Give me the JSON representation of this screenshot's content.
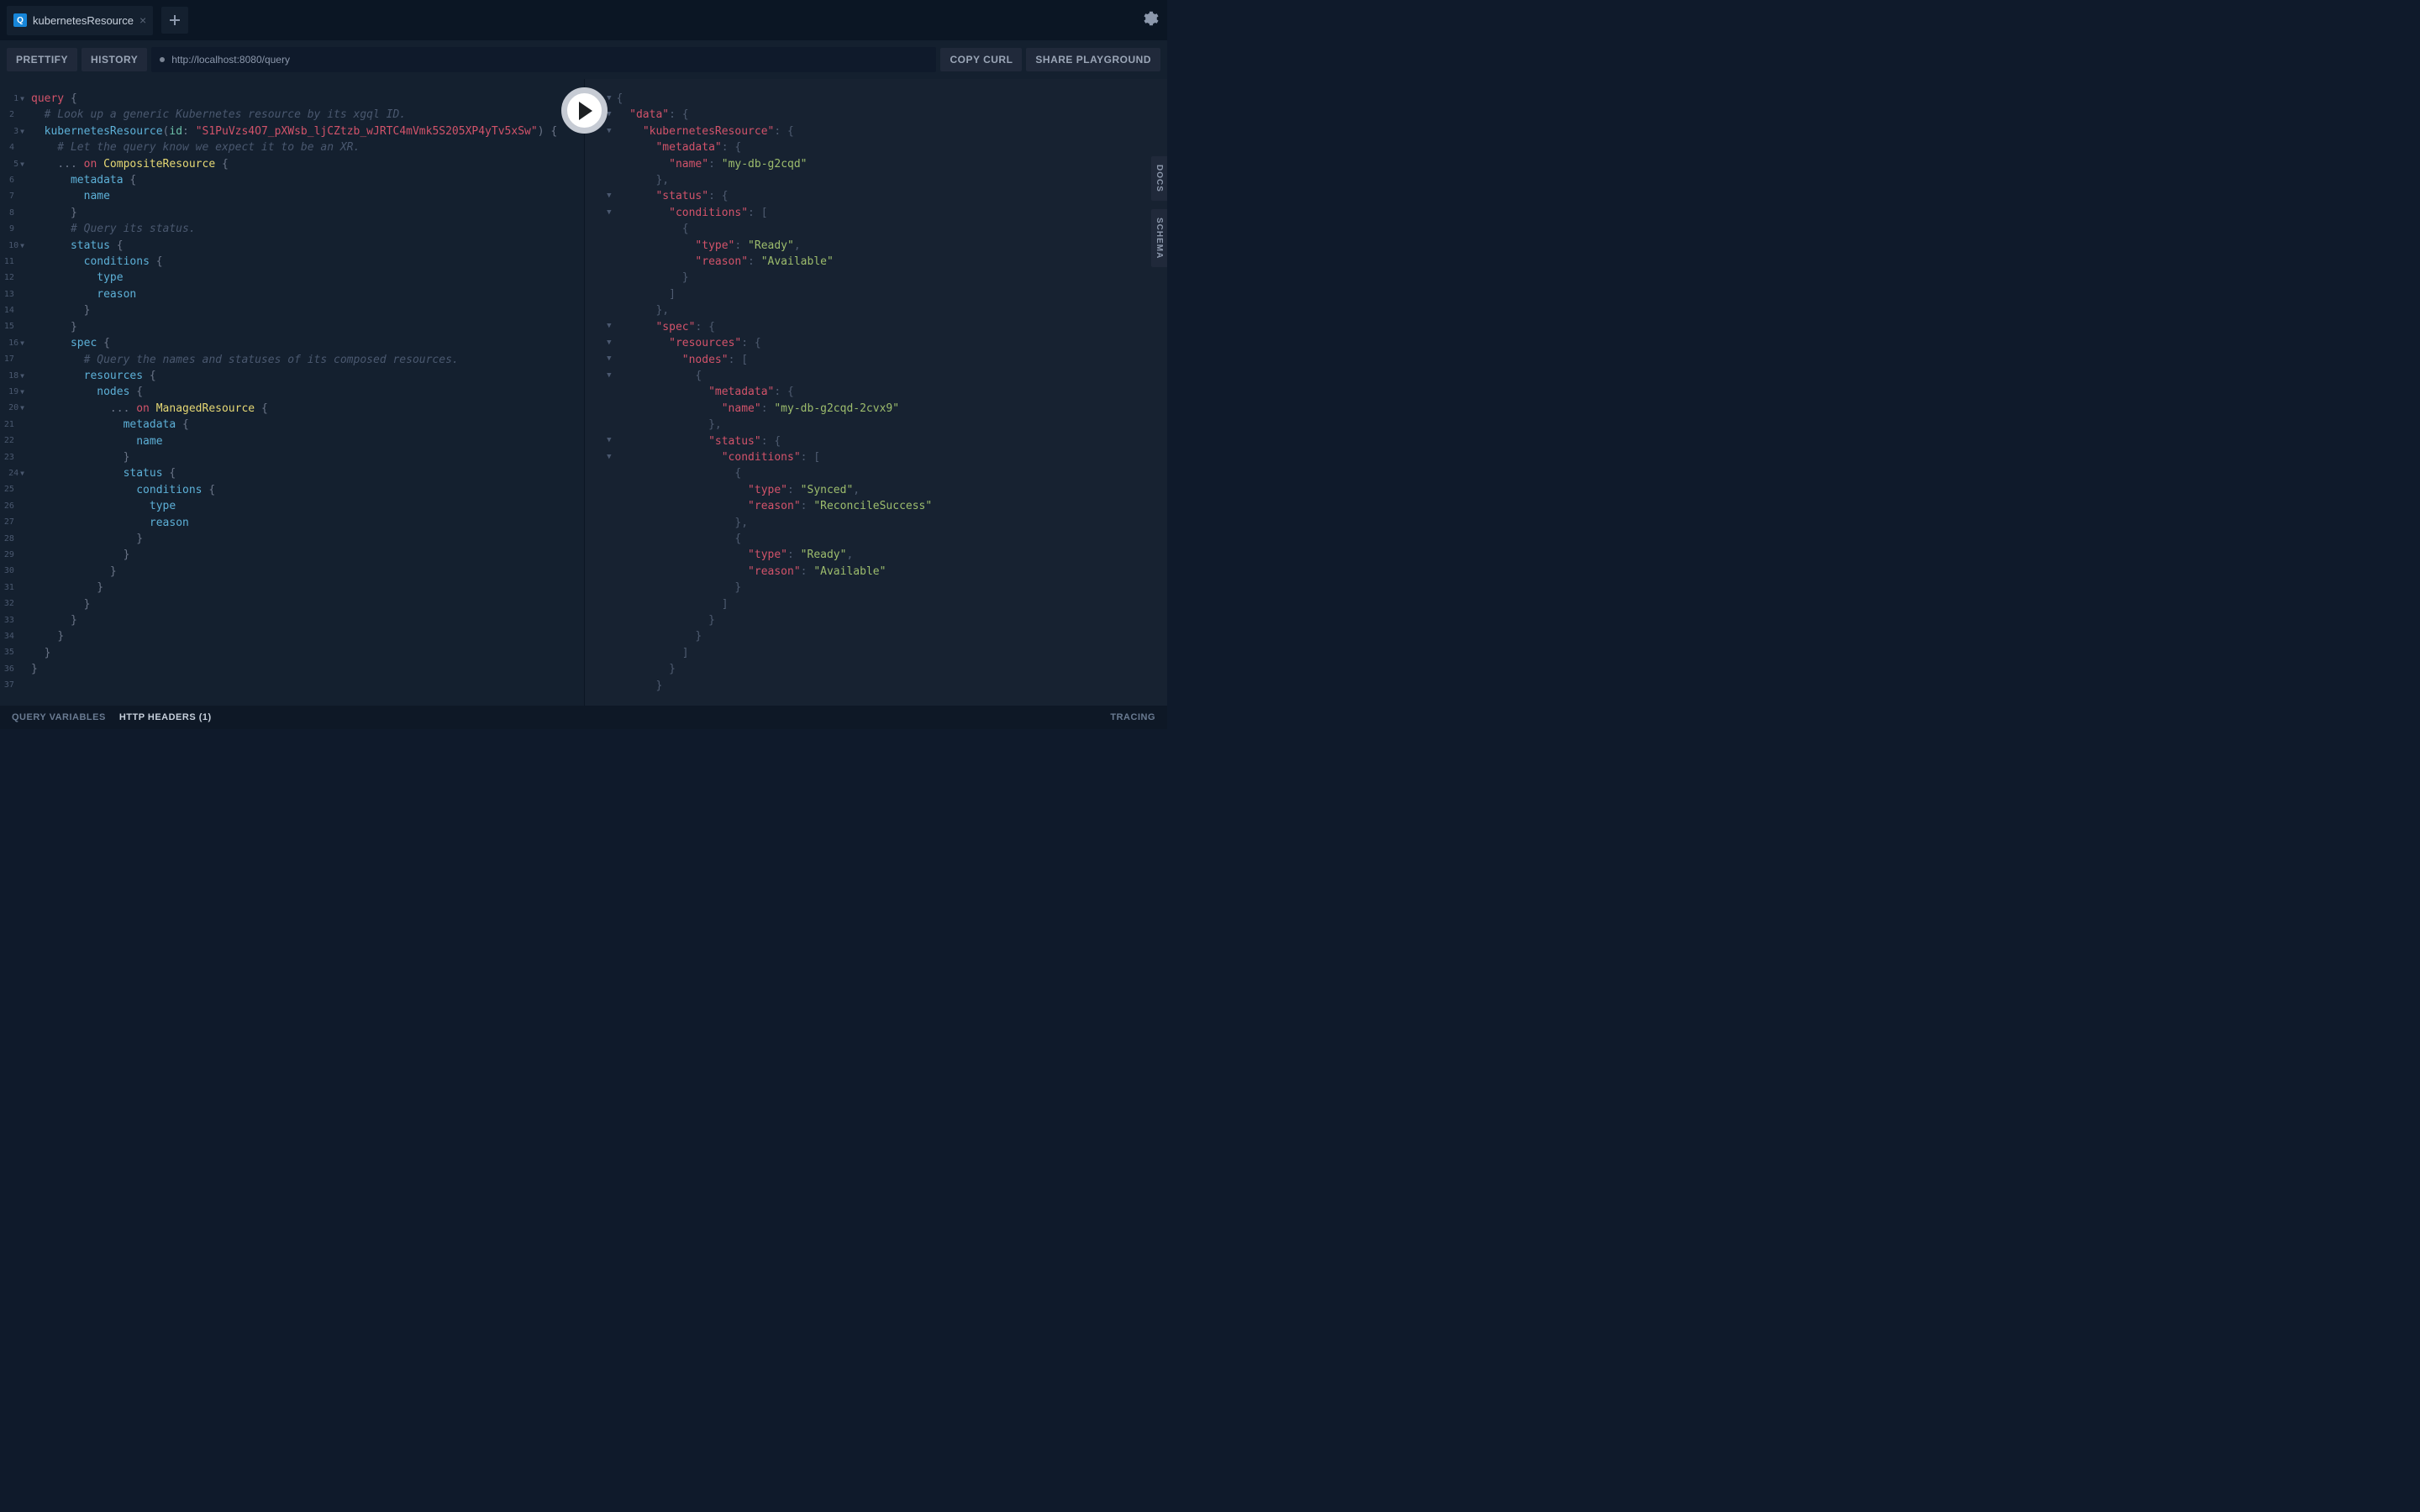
{
  "topbar": {
    "tab_badge": "Q",
    "tab_title": "kubernetesResource",
    "tab_close": "×",
    "new_tab": "+"
  },
  "toolbar": {
    "prettify": "PRETTIFY",
    "history": "HISTORY",
    "url": "http://localhost:8080/query",
    "copy_curl": "COPY CURL",
    "share": "SHARE PLAYGROUND"
  },
  "side": {
    "docs": "DOCS",
    "schema": "SCHEMA"
  },
  "footer": {
    "query_vars": "QUERY VARIABLES",
    "http_headers": "HTTP HEADERS (1)",
    "tracing": "TRACING"
  },
  "query_lines": [
    {
      "n": 1,
      "f": true,
      "tokens": [
        [
          "kw",
          "query"
        ],
        [
          "punct",
          " {"
        ]
      ]
    },
    {
      "n": 2,
      "tokens": [
        [
          "comment",
          "  # Look up a generic Kubernetes resource by its xgql ID."
        ]
      ]
    },
    {
      "n": 3,
      "f": true,
      "tokens": [
        [
          "plain",
          "  "
        ],
        [
          "field",
          "kubernetesResource"
        ],
        [
          "punct",
          "("
        ],
        [
          "arg",
          "id"
        ],
        [
          "punct",
          ": "
        ],
        [
          "str",
          "\"S1PuVzs4O7_pXWsb_ljCZtzb_wJRTC4mVmk5S205XP4yTv5xSw\""
        ],
        [
          "punct",
          ") {"
        ]
      ]
    },
    {
      "n": 4,
      "tokens": [
        [
          "comment",
          "    # Let the query know we expect it to be an XR."
        ]
      ]
    },
    {
      "n": 5,
      "f": true,
      "tokens": [
        [
          "plain",
          "    "
        ],
        [
          "punct",
          "... "
        ],
        [
          "kw",
          "on"
        ],
        [
          "plain",
          " "
        ],
        [
          "type",
          "CompositeResource"
        ],
        [
          "punct",
          " {"
        ]
      ]
    },
    {
      "n": 6,
      "tokens": [
        [
          "plain",
          "      "
        ],
        [
          "field",
          "metadata"
        ],
        [
          "punct",
          " {"
        ]
      ]
    },
    {
      "n": 7,
      "tokens": [
        [
          "plain",
          "        "
        ],
        [
          "field",
          "name"
        ]
      ]
    },
    {
      "n": 8,
      "tokens": [
        [
          "plain",
          "      "
        ],
        [
          "punct",
          "}"
        ]
      ]
    },
    {
      "n": 9,
      "tokens": [
        [
          "comment",
          "      # Query its status."
        ]
      ]
    },
    {
      "n": 10,
      "f": true,
      "tokens": [
        [
          "plain",
          "      "
        ],
        [
          "field",
          "status"
        ],
        [
          "punct",
          " {"
        ]
      ]
    },
    {
      "n": 11,
      "tokens": [
        [
          "plain",
          "        "
        ],
        [
          "field",
          "conditions"
        ],
        [
          "punct",
          " {"
        ]
      ]
    },
    {
      "n": 12,
      "tokens": [
        [
          "plain",
          "          "
        ],
        [
          "field",
          "type"
        ]
      ]
    },
    {
      "n": 13,
      "tokens": [
        [
          "plain",
          "          "
        ],
        [
          "field",
          "reason"
        ]
      ]
    },
    {
      "n": 14,
      "tokens": [
        [
          "plain",
          "        "
        ],
        [
          "punct",
          "}"
        ]
      ]
    },
    {
      "n": 15,
      "tokens": [
        [
          "plain",
          "      "
        ],
        [
          "punct",
          "}"
        ]
      ]
    },
    {
      "n": 16,
      "f": true,
      "tokens": [
        [
          "plain",
          "      "
        ],
        [
          "field",
          "spec"
        ],
        [
          "punct",
          " {"
        ]
      ]
    },
    {
      "n": 17,
      "tokens": [
        [
          "comment",
          "        # Query the names and statuses of its composed resources."
        ]
      ]
    },
    {
      "n": 18,
      "f": true,
      "tokens": [
        [
          "plain",
          "        "
        ],
        [
          "field",
          "resources"
        ],
        [
          "punct",
          " {"
        ]
      ]
    },
    {
      "n": 19,
      "f": true,
      "tokens": [
        [
          "plain",
          "          "
        ],
        [
          "field",
          "nodes"
        ],
        [
          "punct",
          " {"
        ]
      ]
    },
    {
      "n": 20,
      "f": true,
      "tokens": [
        [
          "plain",
          "            "
        ],
        [
          "punct",
          "... "
        ],
        [
          "kw",
          "on"
        ],
        [
          "plain",
          " "
        ],
        [
          "type",
          "ManagedResource"
        ],
        [
          "punct",
          " {"
        ]
      ]
    },
    {
      "n": 21,
      "tokens": [
        [
          "plain",
          "              "
        ],
        [
          "field",
          "metadata"
        ],
        [
          "punct",
          " {"
        ]
      ]
    },
    {
      "n": 22,
      "tokens": [
        [
          "plain",
          "                "
        ],
        [
          "field",
          "name"
        ]
      ]
    },
    {
      "n": 23,
      "tokens": [
        [
          "plain",
          "              "
        ],
        [
          "punct",
          "}"
        ]
      ]
    },
    {
      "n": 24,
      "f": true,
      "tokens": [
        [
          "plain",
          "              "
        ],
        [
          "field",
          "status"
        ],
        [
          "punct",
          " {"
        ]
      ]
    },
    {
      "n": 25,
      "tokens": [
        [
          "plain",
          "                "
        ],
        [
          "field",
          "conditions"
        ],
        [
          "punct",
          " {"
        ]
      ]
    },
    {
      "n": 26,
      "tokens": [
        [
          "plain",
          "                  "
        ],
        [
          "field",
          "type"
        ]
      ]
    },
    {
      "n": 27,
      "tokens": [
        [
          "plain",
          "                  "
        ],
        [
          "field",
          "reason"
        ]
      ]
    },
    {
      "n": 28,
      "tokens": [
        [
          "plain",
          "                "
        ],
        [
          "punct",
          "}"
        ]
      ]
    },
    {
      "n": 29,
      "tokens": [
        [
          "plain",
          "              "
        ],
        [
          "punct",
          "}"
        ]
      ]
    },
    {
      "n": 30,
      "tokens": [
        [
          "plain",
          "            "
        ],
        [
          "punct",
          "}"
        ]
      ]
    },
    {
      "n": 31,
      "tokens": [
        [
          "plain",
          "          "
        ],
        [
          "punct",
          "}"
        ]
      ]
    },
    {
      "n": 32,
      "tokens": [
        [
          "plain",
          "        "
        ],
        [
          "punct",
          "}"
        ]
      ]
    },
    {
      "n": 33,
      "tokens": [
        [
          "plain",
          "      "
        ],
        [
          "punct",
          "}"
        ]
      ]
    },
    {
      "n": 34,
      "tokens": [
        [
          "plain",
          "    "
        ],
        [
          "punct",
          "}"
        ]
      ]
    },
    {
      "n": 35,
      "tokens": [
        [
          "plain",
          "  "
        ],
        [
          "punct",
          "}"
        ]
      ]
    },
    {
      "n": 36,
      "tokens": [
        [
          "punct",
          "}"
        ]
      ]
    },
    {
      "n": 37,
      "tokens": [
        [
          "plain",
          ""
        ]
      ]
    }
  ],
  "result_lines": [
    {
      "f": true,
      "tokens": [
        [
          "jpunct",
          "{"
        ]
      ]
    },
    {
      "f": true,
      "tokens": [
        [
          "plain",
          "  "
        ],
        [
          "jkey",
          "\"data\""
        ],
        [
          "jpunct",
          ": {"
        ]
      ]
    },
    {
      "f": true,
      "tokens": [
        [
          "plain",
          "    "
        ],
        [
          "jkey",
          "\"kubernetesResource\""
        ],
        [
          "jpunct",
          ": {"
        ]
      ]
    },
    {
      "tokens": [
        [
          "plain",
          "      "
        ],
        [
          "jkey",
          "\"metadata\""
        ],
        [
          "jpunct",
          ": {"
        ]
      ]
    },
    {
      "tokens": [
        [
          "plain",
          "        "
        ],
        [
          "jkey",
          "\"name\""
        ],
        [
          "jpunct",
          ": "
        ],
        [
          "jstr",
          "\"my-db-g2cqd\""
        ]
      ]
    },
    {
      "tokens": [
        [
          "plain",
          "      "
        ],
        [
          "jpunct",
          "},"
        ]
      ]
    },
    {
      "f": true,
      "tokens": [
        [
          "plain",
          "      "
        ],
        [
          "jkey",
          "\"status\""
        ],
        [
          "jpunct",
          ": {"
        ]
      ]
    },
    {
      "f": true,
      "tokens": [
        [
          "plain",
          "        "
        ],
        [
          "jkey",
          "\"conditions\""
        ],
        [
          "jpunct",
          ": ["
        ]
      ]
    },
    {
      "tokens": [
        [
          "plain",
          "          "
        ],
        [
          "jpunct",
          "{"
        ]
      ]
    },
    {
      "tokens": [
        [
          "plain",
          "            "
        ],
        [
          "jkey",
          "\"type\""
        ],
        [
          "jpunct",
          ": "
        ],
        [
          "jstr",
          "\"Ready\""
        ],
        [
          "jpunct",
          ","
        ]
      ]
    },
    {
      "tokens": [
        [
          "plain",
          "            "
        ],
        [
          "jkey",
          "\"reason\""
        ],
        [
          "jpunct",
          ": "
        ],
        [
          "jstr",
          "\"Available\""
        ]
      ]
    },
    {
      "tokens": [
        [
          "plain",
          "          "
        ],
        [
          "jpunct",
          "}"
        ]
      ]
    },
    {
      "tokens": [
        [
          "plain",
          "        "
        ],
        [
          "jpunct",
          "]"
        ]
      ]
    },
    {
      "tokens": [
        [
          "plain",
          "      "
        ],
        [
          "jpunct",
          "},"
        ]
      ]
    },
    {
      "f": true,
      "tokens": [
        [
          "plain",
          "      "
        ],
        [
          "jkey",
          "\"spec\""
        ],
        [
          "jpunct",
          ": {"
        ]
      ]
    },
    {
      "f": true,
      "tokens": [
        [
          "plain",
          "        "
        ],
        [
          "jkey",
          "\"resources\""
        ],
        [
          "jpunct",
          ": {"
        ]
      ]
    },
    {
      "f": true,
      "tokens": [
        [
          "plain",
          "          "
        ],
        [
          "jkey",
          "\"nodes\""
        ],
        [
          "jpunct",
          ": ["
        ]
      ]
    },
    {
      "f": true,
      "tokens": [
        [
          "plain",
          "            "
        ],
        [
          "jpunct",
          "{"
        ]
      ]
    },
    {
      "tokens": [
        [
          "plain",
          "              "
        ],
        [
          "jkey",
          "\"metadata\""
        ],
        [
          "jpunct",
          ": {"
        ]
      ]
    },
    {
      "tokens": [
        [
          "plain",
          "                "
        ],
        [
          "jkey",
          "\"name\""
        ],
        [
          "jpunct",
          ": "
        ],
        [
          "jstr",
          "\"my-db-g2cqd-2cvx9\""
        ]
      ]
    },
    {
      "tokens": [
        [
          "plain",
          "              "
        ],
        [
          "jpunct",
          "},"
        ]
      ]
    },
    {
      "f": true,
      "tokens": [
        [
          "plain",
          "              "
        ],
        [
          "jkey",
          "\"status\""
        ],
        [
          "jpunct",
          ": {"
        ]
      ]
    },
    {
      "f": true,
      "tokens": [
        [
          "plain",
          "                "
        ],
        [
          "jkey",
          "\"conditions\""
        ],
        [
          "jpunct",
          ": ["
        ]
      ]
    },
    {
      "tokens": [
        [
          "plain",
          "                  "
        ],
        [
          "jpunct",
          "{"
        ]
      ]
    },
    {
      "tokens": [
        [
          "plain",
          "                    "
        ],
        [
          "jkey",
          "\"type\""
        ],
        [
          "jpunct",
          ": "
        ],
        [
          "jstr",
          "\"Synced\""
        ],
        [
          "jpunct",
          ","
        ]
      ]
    },
    {
      "tokens": [
        [
          "plain",
          "                    "
        ],
        [
          "jkey",
          "\"reason\""
        ],
        [
          "jpunct",
          ": "
        ],
        [
          "jstr",
          "\"ReconcileSuccess\""
        ]
      ]
    },
    {
      "tokens": [
        [
          "plain",
          "                  "
        ],
        [
          "jpunct",
          "},"
        ]
      ]
    },
    {
      "tokens": [
        [
          "plain",
          "                  "
        ],
        [
          "jpunct",
          "{"
        ]
      ]
    },
    {
      "tokens": [
        [
          "plain",
          "                    "
        ],
        [
          "jkey",
          "\"type\""
        ],
        [
          "jpunct",
          ": "
        ],
        [
          "jstr",
          "\"Ready\""
        ],
        [
          "jpunct",
          ","
        ]
      ]
    },
    {
      "tokens": [
        [
          "plain",
          "                    "
        ],
        [
          "jkey",
          "\"reason\""
        ],
        [
          "jpunct",
          ": "
        ],
        [
          "jstr",
          "\"Available\""
        ]
      ]
    },
    {
      "tokens": [
        [
          "plain",
          "                  "
        ],
        [
          "jpunct",
          "}"
        ]
      ]
    },
    {
      "tokens": [
        [
          "plain",
          "                "
        ],
        [
          "jpunct",
          "]"
        ]
      ]
    },
    {
      "tokens": [
        [
          "plain",
          "              "
        ],
        [
          "jpunct",
          "}"
        ]
      ]
    },
    {
      "tokens": [
        [
          "plain",
          "            "
        ],
        [
          "jpunct",
          "}"
        ]
      ]
    },
    {
      "tokens": [
        [
          "plain",
          "          "
        ],
        [
          "jpunct",
          "]"
        ]
      ]
    },
    {
      "tokens": [
        [
          "plain",
          "        "
        ],
        [
          "jpunct",
          "}"
        ]
      ]
    },
    {
      "tokens": [
        [
          "plain",
          "      "
        ],
        [
          "jpunct",
          "}"
        ]
      ]
    }
  ]
}
